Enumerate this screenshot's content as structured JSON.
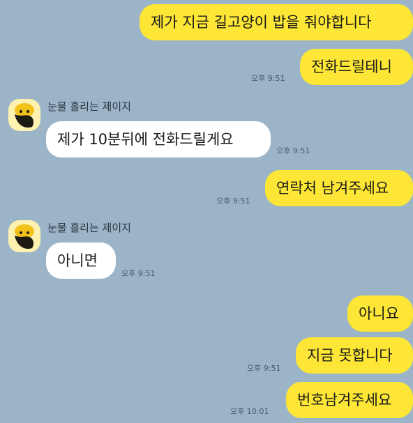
{
  "colors": {
    "background": "#9bb4c8",
    "outgoing_bubble": "#fde635",
    "incoming_bubble": "#ffffff"
  },
  "messages": [
    {
      "direction": "out",
      "text": "제가 지금 길고양이 밥을 줘야합니다"
    },
    {
      "direction": "out",
      "text": "전화드릴테니",
      "time": "오후 9:51"
    },
    {
      "direction": "in",
      "sender": "눈물 흘리는 제이지",
      "text": "제가 10분뒤에 전화드릴게요",
      "time": "오후 9:51"
    },
    {
      "direction": "out",
      "text": "연락처 남겨주세요",
      "time": "오후 9:51"
    },
    {
      "direction": "in",
      "sender": "눈물 흘리는 제이지",
      "text": "아니면",
      "time": "오후 9:51"
    },
    {
      "direction": "out",
      "text": "아니요"
    },
    {
      "direction": "out",
      "text": "지금 못합니다",
      "time": "오후 9:51"
    },
    {
      "direction": "out",
      "text": "번호남겨주세요",
      "time": "오후 10:01"
    }
  ]
}
